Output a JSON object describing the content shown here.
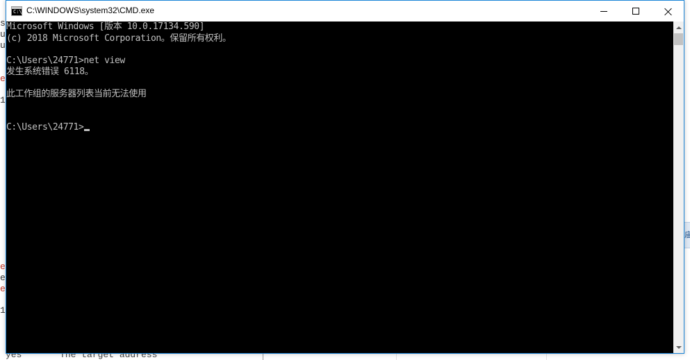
{
  "window": {
    "title": "C:\\WINDOWS\\system32\\CMD.exe",
    "border_color": "#1883d7",
    "console_bg": "#000000",
    "console_fg": "#c0c0c0"
  },
  "console": {
    "lines": [
      "Microsoft Windows [版本 10.0.17134.590]",
      "(c) 2018 Microsoft Corporation。保留所有权利。",
      "",
      "C:\\Users\\24771>net view",
      "发生系统错误 6118。",
      "",
      "此工作组的服务器列表当前无法使用",
      "",
      "",
      "C:\\Users\\24771>"
    ]
  },
  "background": {
    "gutter_fragments": [
      "s",
      "u",
      "u",
      "e",
      "1",
      "e",
      "e",
      "e",
      "1"
    ],
    "bottom_text": "yes       The target address",
    "right_tab_char": "庙"
  },
  "icons": {
    "app_icon": "cmd-app-icon",
    "minimize": "minimize-icon",
    "maximize": "maximize-icon",
    "close": "close-icon"
  }
}
